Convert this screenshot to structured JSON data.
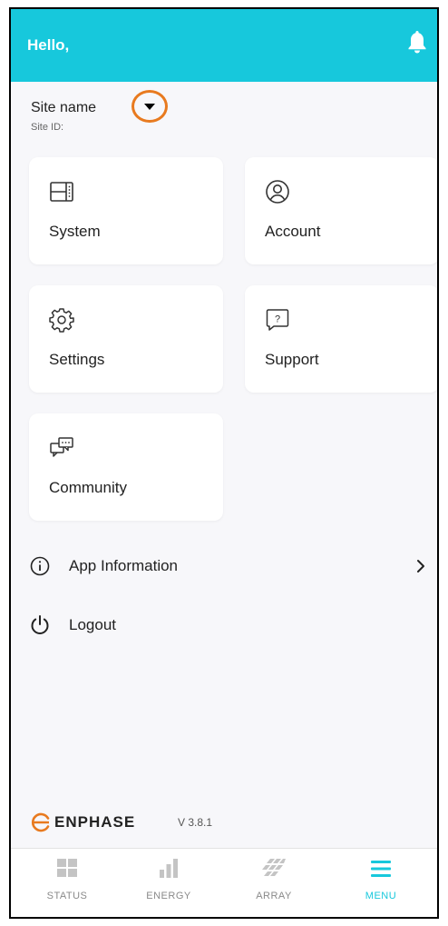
{
  "header": {
    "greeting": "Hello,",
    "bell_icon": "bell-icon"
  },
  "site": {
    "name": "Site name",
    "id_label": "Site ID:",
    "dropdown_icon": "chevron-down-icon",
    "highlight_color": "#e87a1f"
  },
  "cards": [
    {
      "label": "System",
      "icon": "system-panel-icon"
    },
    {
      "label": "Account",
      "icon": "user-circle-icon"
    },
    {
      "label": "Settings",
      "icon": "gear-icon"
    },
    {
      "label": "Support",
      "icon": "help-bubble-icon"
    },
    {
      "label": "Community",
      "icon": "chat-bubbles-icon"
    }
  ],
  "menu_rows": [
    {
      "label": "App Information",
      "icon": "info-icon",
      "trailing": "chevron-right-icon"
    },
    {
      "label": "Logout",
      "icon": "power-icon"
    }
  ],
  "footer": {
    "brand": "ENPHASE",
    "version": "V 3.8.1"
  },
  "tabs": [
    {
      "label": "STATUS",
      "icon": "grid-icon",
      "active": false
    },
    {
      "label": "ENERGY",
      "icon": "bar-chart-icon",
      "active": false
    },
    {
      "label": "ARRAY",
      "icon": "array-panels-icon",
      "active": false
    },
    {
      "label": "MENU",
      "icon": "hamburger-icon",
      "active": true
    }
  ],
  "colors": {
    "accent": "#17c8dc",
    "background": "#f7f7fa",
    "card": "#ffffff"
  }
}
